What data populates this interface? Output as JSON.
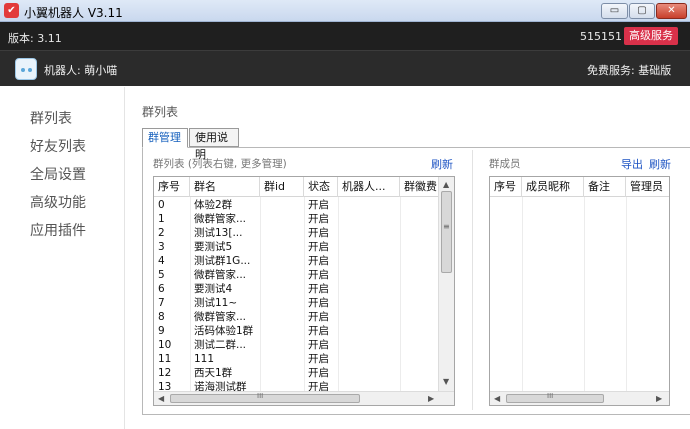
{
  "window": {
    "icon": "app-logo-icon",
    "title": "小翼机器人 V3.11",
    "controls": {
      "minimize": "▭",
      "maximize": "▢",
      "close": "✕"
    }
  },
  "version_bar": {
    "version_text": "版本: 3.11",
    "account_id": "515151",
    "premium_button": "高级服务"
  },
  "robot_bar": {
    "avatar_icon": "robot-avatar-icon",
    "robot_label": "机器人: 萌小喵",
    "service_label": "免费服务: 基础版"
  },
  "nav": {
    "items": [
      {
        "label": "群列表"
      },
      {
        "label": "好友列表"
      },
      {
        "label": "全局设置"
      },
      {
        "label": "高级功能"
      },
      {
        "label": "应用插件"
      }
    ]
  },
  "main": {
    "section_title": "群列表",
    "tabs": [
      {
        "label": "群管理",
        "active": true
      },
      {
        "label": "使用说明",
        "active": false
      }
    ],
    "group_panel": {
      "caption": "群列表 (列表右键, 更多管理)",
      "refresh": "刷新",
      "columns": [
        "序号",
        "群名",
        "群id",
        "状态",
        "机器人...",
        "群徽费"
      ],
      "rows": [
        {
          "idx": "0",
          "name": "体验2群",
          "status": "开启"
        },
        {
          "idx": "1",
          "name": "微群管家...",
          "status": "开启"
        },
        {
          "idx": "2",
          "name": "测试13[...",
          "status": "开启"
        },
        {
          "idx": "3",
          "name": "要测试5",
          "status": "开启"
        },
        {
          "idx": "4",
          "name": "测试群1G...",
          "status": "开启"
        },
        {
          "idx": "5",
          "name": "微群管家...",
          "status": "开启"
        },
        {
          "idx": "6",
          "name": "要测试4",
          "status": "开启"
        },
        {
          "idx": "7",
          "name": "测试11~",
          "status": "开启"
        },
        {
          "idx": "8",
          "name": "微群管家...",
          "status": "开启"
        },
        {
          "idx": "9",
          "name": "活码体验1群",
          "status": "开启"
        },
        {
          "idx": "10",
          "name": "测试二群...",
          "status": "开启"
        },
        {
          "idx": "11",
          "name": "111",
          "status": "开启"
        },
        {
          "idx": "12",
          "name": "西天1群",
          "status": "开启"
        },
        {
          "idx": "13",
          "name": "诺海测试群",
          "status": "开启"
        }
      ]
    },
    "member_panel": {
      "caption": "群成员",
      "export": "导出",
      "refresh": "刷新",
      "columns": [
        "序号",
        "成员昵称",
        "备注",
        "管理员"
      ]
    },
    "scroll_glyphs": {
      "up": "▲",
      "down": "▼",
      "left": "◀",
      "right": "▶",
      "grip": "≡",
      "hgrip": "III"
    }
  }
}
